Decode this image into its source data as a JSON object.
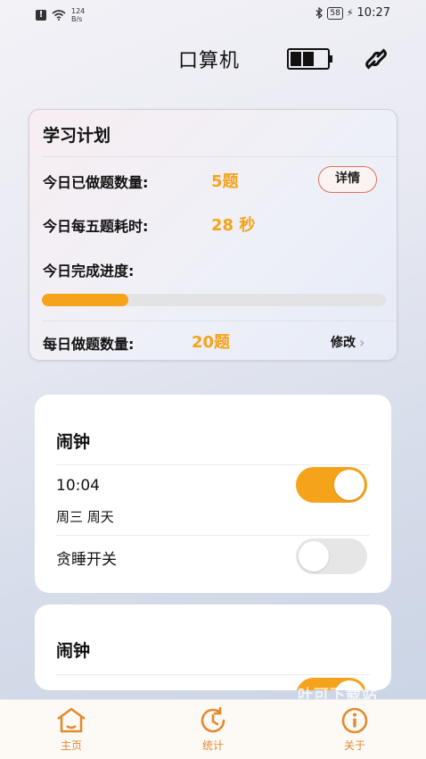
{
  "status_bar": {
    "net_speed_value": "124",
    "net_speed_unit": "B/s",
    "battery_level": "58",
    "time": "10:27"
  },
  "header": {
    "title": "口算机",
    "battery_icon": "battery-icon",
    "link_icon": "link-icon"
  },
  "plan": {
    "title": "学习计划",
    "done_label": "今日已做题数量:",
    "done_value": "5题",
    "detail_label": "详情",
    "time_label": "今日每五题耗时:",
    "time_value": "28 秒",
    "progress_label": "今日完成进度:",
    "progress_fraction": 0.25,
    "daily_label": "每日做题数量:",
    "daily_value": "20题",
    "modify_label": "修改",
    "modify_chevron": "›"
  },
  "alarms": [
    {
      "title": "闹钟",
      "time": "10:04",
      "days": "周三 周天",
      "enabled": true,
      "snooze_label": "贪睡开关",
      "snooze_enabled": false
    },
    {
      "title": "闹钟",
      "enabled": true
    }
  ],
  "watermark": "叶可下载站",
  "nav": {
    "home_label": "主页",
    "stats_label": "统计",
    "about_label": "关于"
  },
  "colors": {
    "accent": "#f5a31a",
    "nav_accent": "#e38a2e",
    "detail_border": "#e0705c"
  }
}
